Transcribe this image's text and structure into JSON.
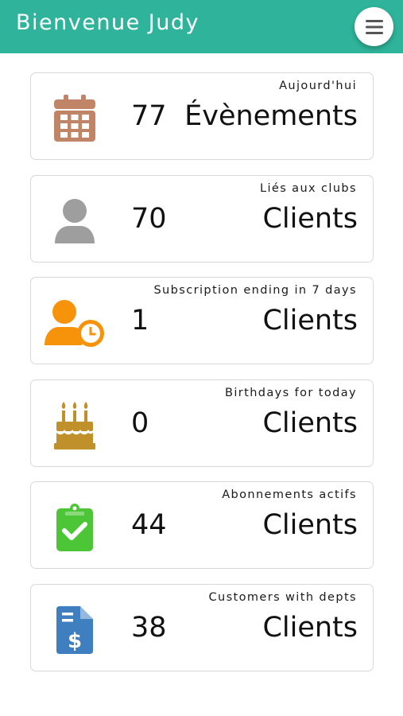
{
  "header": {
    "title": "Bienvenue Judy",
    "background_color": "#2fb39a",
    "menu_icon": "hamburger-menu-icon"
  },
  "cards": [
    {
      "caption": "Aujourd'hui",
      "count": "77",
      "unit": "Évènements",
      "icon": "calendar-icon",
      "icon_color": "#c08466"
    },
    {
      "caption": "Liés aux clubs",
      "count": "70",
      "unit": "Clients",
      "icon": "user-icon",
      "icon_color": "#9e9e9e"
    },
    {
      "caption": "Subscription ending in 7 days",
      "count": "1",
      "unit": "Clients",
      "icon": "user-clock-icon",
      "icon_color": "#f7930a"
    },
    {
      "caption": "Birthdays for today",
      "count": "0",
      "unit": "Clients",
      "icon": "birthday-cake-icon",
      "icon_color": "#c0902a"
    },
    {
      "caption": "Abonnements actifs",
      "count": "44",
      "unit": "Clients",
      "icon": "clipboard-check-icon",
      "icon_color": "#4cc537"
    },
    {
      "caption": "Customers with depts",
      "count": "38",
      "unit": "Clients",
      "icon": "invoice-dollar-icon",
      "icon_color": "#3f7fbf"
    }
  ]
}
